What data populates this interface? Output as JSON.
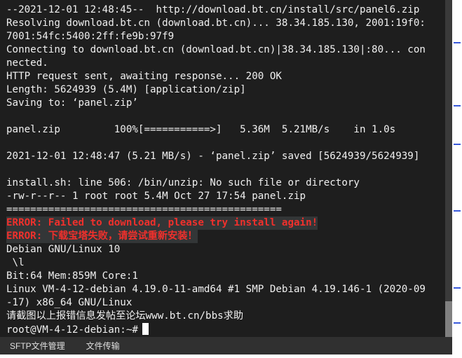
{
  "terminal": {
    "lines": [
      "--2021-12-01 12:48:45--  http://download.bt.cn/install/src/panel6.zip",
      "Resolving download.bt.cn (download.bt.cn)... 38.34.185.130, 2001:19f0:",
      "7001:54fc:5400:2ff:fe9b:97f9",
      "Connecting to download.bt.cn (download.bt.cn)|38.34.185.130|:80... con",
      "nected.",
      "HTTP request sent, awaiting response... 200 OK",
      "Length: 5624939 (5.4M) [application/zip]",
      "Saving to: ‘panel.zip’",
      "",
      "panel.zip         100%[===========>]   5.36M  5.21MB/s    in 1.0s",
      "",
      "2021-12-01 12:48:47 (5.21 MB/s) - ‘panel.zip’ saved [5624939/5624939]",
      "",
      "install.sh: line 506: /bin/unzip: No such file or directory",
      "-rw-r--r-- 1 root root 5.4M Oct 27 17:54 panel.zip",
      "=============================================="
    ],
    "errors": [
      "ERROR: Failed to download, please try install again!",
      "ERROR: 下载宝塔失败，请尝试重新安装！"
    ],
    "after": [
      "Debian GNU/Linux 10",
      " \\l",
      "Bit:64 Mem:859M Core:1",
      "Linux VM-4-12-debian 4.19.0-11-amd64 #1 SMP Debian 4.19.146-1 (2020-09",
      "-17) x86_64 GNU/Linux",
      "请截图以上报错信息发帖至论坛www.bt.cn/bbs求助"
    ],
    "prompt": "root@VM-4-12-debian:~#",
    "error_color": "#f0302c"
  },
  "bottombar": {
    "sftp_label": "SFTP文件管理",
    "transfer_label": "文件传输"
  }
}
